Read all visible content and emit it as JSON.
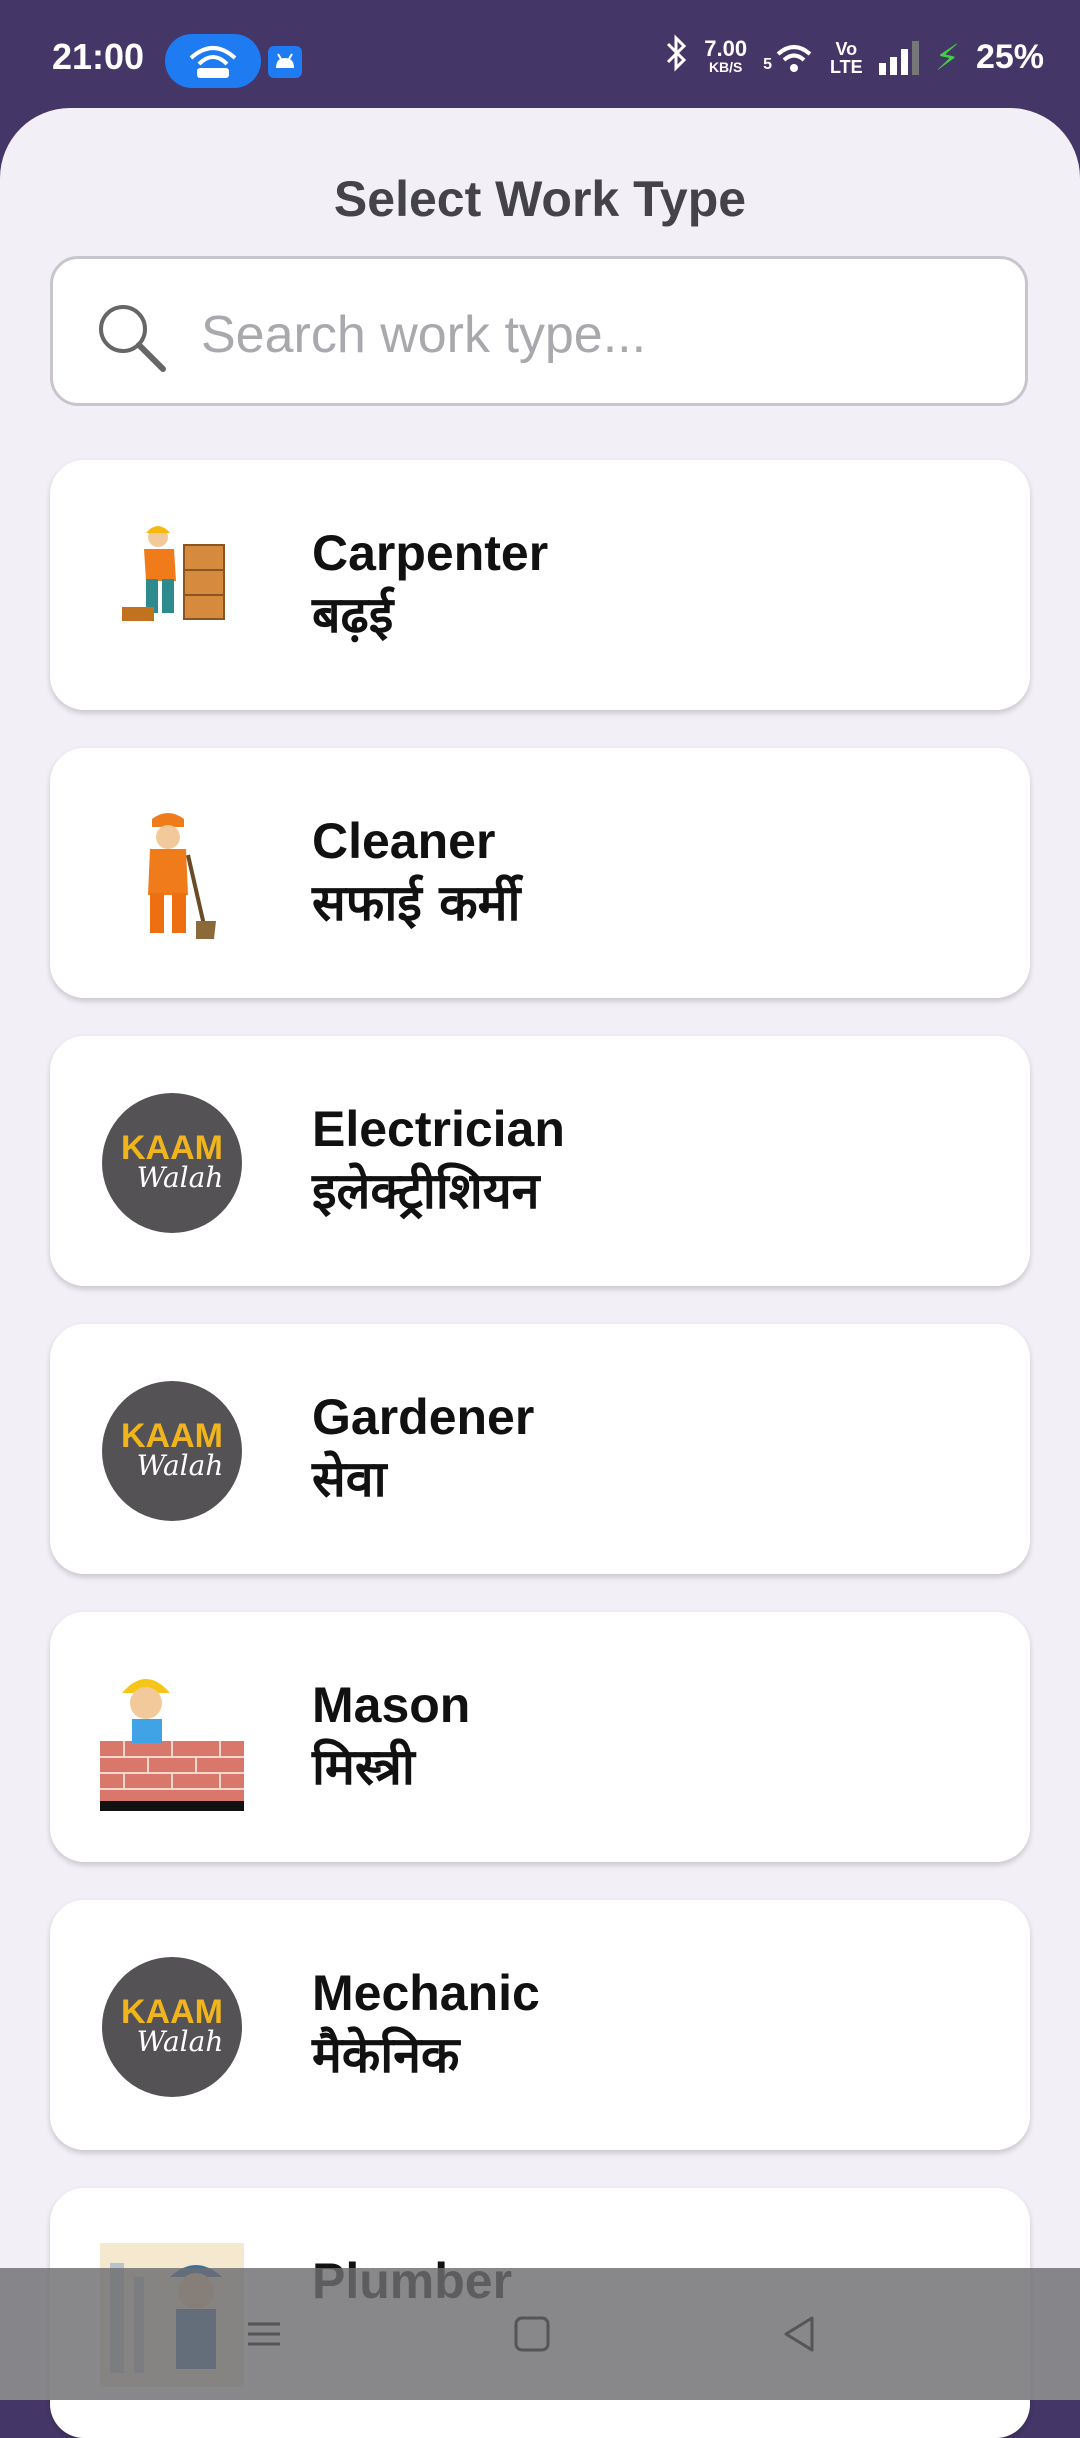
{
  "status_bar": {
    "time": "21:00",
    "net_speed_value": "7.00",
    "net_speed_unit": "KB/S",
    "wifi_label": "5",
    "volte_top": "Vo",
    "volte_bottom": "LTE",
    "battery": "25%",
    "icons": [
      "hotspot-icon",
      "android-icon",
      "bluetooth-icon",
      "wifi-icon",
      "signal-icon",
      "charging-icon"
    ]
  },
  "sheet": {
    "title": "Select Work Type",
    "search_placeholder": "Search work type..."
  },
  "work_types": [
    {
      "en": "Carpenter",
      "hi": "बढ़ई",
      "icon": "carpenter-illustration"
    },
    {
      "en": "Cleaner",
      "hi": "सफाई कर्मी",
      "icon": "cleaner-illustration"
    },
    {
      "en": "Electrician",
      "hi": "इलेक्ट्रीशियन",
      "icon": "kaam-walah-logo"
    },
    {
      "en": "Gardener",
      "hi": "सेवा",
      "icon": "kaam-walah-logo"
    },
    {
      "en": "Mason",
      "hi": "मिस्त्री",
      "icon": "mason-illustration"
    },
    {
      "en": "Mechanic",
      "hi": "मैकेनिक",
      "icon": "kaam-walah-logo"
    },
    {
      "en": "Plumber",
      "hi": "",
      "icon": "plumber-illustration"
    }
  ],
  "logo_text": {
    "top": "KAAM",
    "bottom": "Walah"
  },
  "colors": {
    "status_bar": "#453668",
    "sheet_bg": "#f3eff7",
    "logo_bg": "#545254",
    "logo_accent": "#f0b51d"
  },
  "nav_bar": {
    "icons": [
      "menu-icon",
      "home-icon",
      "back-icon"
    ]
  }
}
